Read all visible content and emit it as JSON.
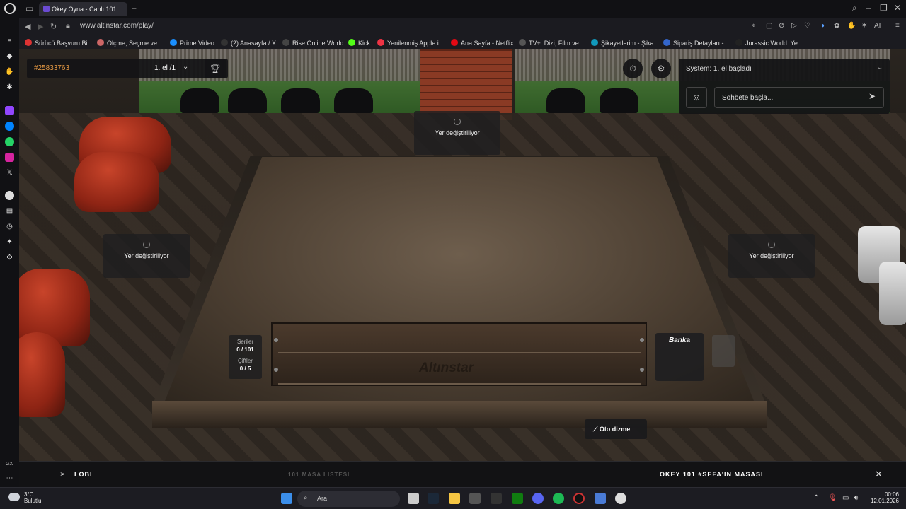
{
  "browser": {
    "tab_title": "Okey Oyna - Canlı 101",
    "new_tab": "+",
    "url": "www.altinstar.com/play/",
    "bookmarks": [
      {
        "label": "Sürücü Başvuru Bi...",
        "color": "#d33"
      },
      {
        "label": "Ölçme, Seçme ve...",
        "color": "#c66"
      },
      {
        "label": "Prime Video",
        "color": "#1a8fff"
      },
      {
        "label": "(2) Anasayfa / X",
        "color": "#333"
      },
      {
        "label": "Rise Online World",
        "color": "#444"
      },
      {
        "label": "Kick",
        "color": "#53fc18"
      },
      {
        "label": "Yenilenmiş Apple i...",
        "color": "#e34"
      },
      {
        "label": "Ana Sayfa - Netflix",
        "color": "#e50914"
      },
      {
        "label": "TV+: Dizi, Film ve...",
        "color": "#555"
      },
      {
        "label": "Şikayetlerim - Şika...",
        "color": "#19b"
      },
      {
        "label": "Sipariş Detayları -...",
        "color": "#36c"
      },
      {
        "label": "Jurassic World: Ye...",
        "color": "#222"
      }
    ],
    "toolbar_ai": "AI"
  },
  "game": {
    "table_id": "#25833763",
    "round": "1. el /1",
    "seats": {
      "top": "Yer değiştiriliyor",
      "left": "Yer değiştiriliyor",
      "right": "Yer değiştiriliyor"
    },
    "stats": {
      "series_label": "Seriler",
      "series_value": "0 / 101",
      "pairs_label": "Çiftler",
      "pairs_value": "0 / 5"
    },
    "rack_brand": "Altınstar",
    "bank_label": "Banka",
    "auto_sort": "Oto dizme"
  },
  "chat": {
    "system_message": "System: 1. el başladı",
    "placeholder": "Sohbete başla..."
  },
  "bottom_bar": {
    "lobby": "LOBI",
    "table_list": "101 MASA LISTESI",
    "table_name": "OKEY 101 #SEFA'IN MASASI"
  },
  "taskbar": {
    "weather_temp": "3°C",
    "weather_desc": "Bulutlu",
    "search": "Ara",
    "time": "00:06",
    "date": "12.01.2026"
  },
  "sidebar": {
    "gx_label": "GX"
  }
}
